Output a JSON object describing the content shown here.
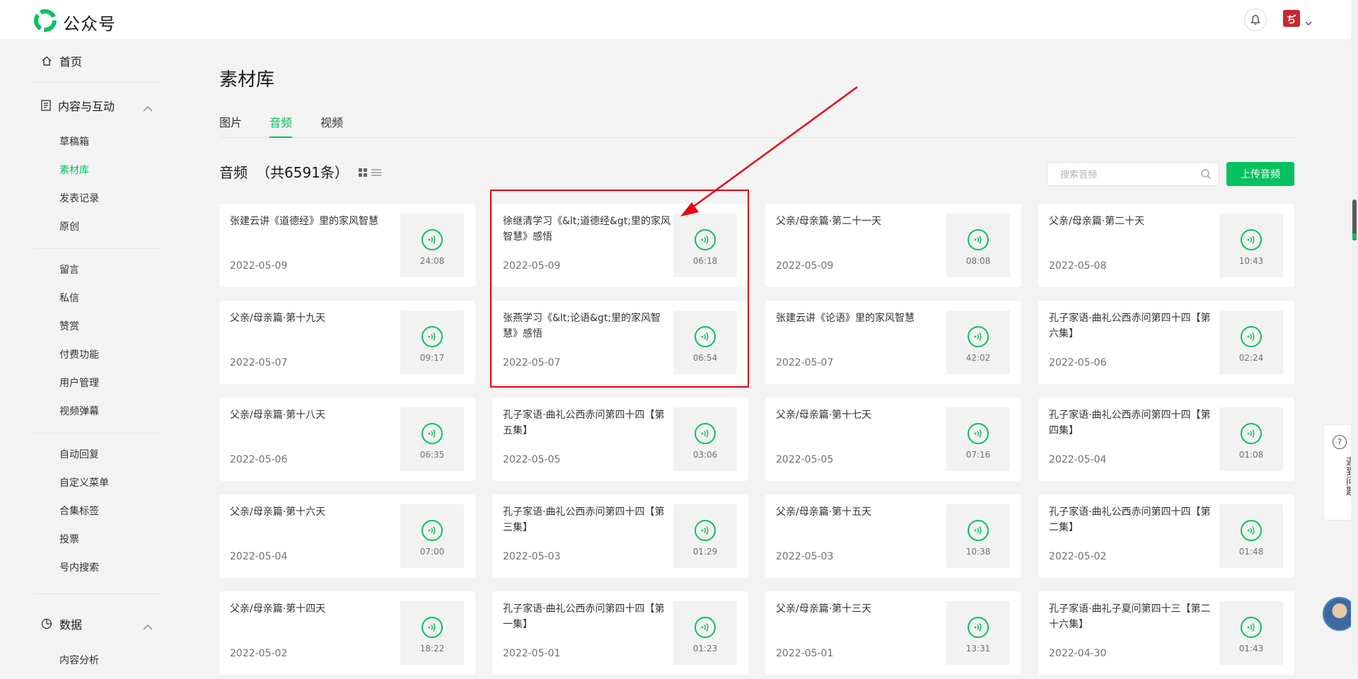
{
  "brand": {
    "name": "公众号",
    "logo_icon": "wechat-official-account-icon",
    "accent": "#07c160"
  },
  "header": {
    "bell_icon": "bell-icon",
    "account_avatar_text": "ぢ"
  },
  "sidebar": {
    "home": "首页",
    "content_group": {
      "label": "内容与互动",
      "items": [
        "草稿箱",
        "素材库",
        "发表记录",
        "原创",
        "留言",
        "私信",
        "赞赏",
        "付费功能",
        "用户管理",
        "视频弹幕",
        "自动回复",
        "自定义菜单",
        "合集标签",
        "投票",
        "号内搜索"
      ],
      "active": "素材库"
    },
    "data_group": {
      "label": "数据",
      "items": [
        "内容分析"
      ]
    }
  },
  "main": {
    "title": "素材库",
    "tabs": [
      "图片",
      "音频",
      "视频"
    ],
    "active_tab": "音频",
    "list_title": "音频",
    "count_text": "（共6591条）",
    "search_placeholder": "搜索音频",
    "upload_label": "上传音频"
  },
  "cards": [
    {
      "title": "张建云讲《道德经》里的家风智慧",
      "date": "2022-05-09",
      "duration": "24:08"
    },
    {
      "title": "徐继清学习《&lt;道德经&gt;里的家风智慧》感悟",
      "date": "2022-05-09",
      "duration": "06:18"
    },
    {
      "title": "父亲/母亲篇·第二十一天",
      "date": "2022-05-09",
      "duration": "08:08"
    },
    {
      "title": "父亲/母亲篇·第二十天",
      "date": "2022-05-08",
      "duration": "10:43"
    },
    {
      "title": "父亲/母亲篇·第十九天",
      "date": "2022-05-07",
      "duration": "09:17"
    },
    {
      "title": "张燕学习《&lt;论语&gt;里的家风智慧》感悟",
      "date": "2022-05-07",
      "duration": "06:54"
    },
    {
      "title": "张建云讲《论语》里的家风智慧",
      "date": "2022-05-07",
      "duration": "42:02"
    },
    {
      "title": "孔子家语·曲礼公西赤问第四十四【第六集】",
      "date": "2022-05-06",
      "duration": "02:24"
    },
    {
      "title": "父亲/母亲篇·第十八天",
      "date": "2022-05-06",
      "duration": "06:35"
    },
    {
      "title": "孔子家语·曲礼公西赤问第四十四【第五集】",
      "date": "2022-05-05",
      "duration": "03:06"
    },
    {
      "title": "父亲/母亲篇·第十七天",
      "date": "2022-05-05",
      "duration": "07:16"
    },
    {
      "title": "孔子家语·曲礼公西赤问第四十四【第四集】",
      "date": "2022-05-04",
      "duration": "01:08"
    },
    {
      "title": "父亲/母亲篇·第十六天",
      "date": "2022-05-04",
      "duration": "07:00"
    },
    {
      "title": "孔子家语·曲礼公西赤问第四十四【第三集】",
      "date": "2022-05-03",
      "duration": "01:29"
    },
    {
      "title": "父亲/母亲篇·第十五天",
      "date": "2022-05-03",
      "duration": "10:38"
    },
    {
      "title": "孔子家语·曲礼公西赤问第四十四【第二集】",
      "date": "2022-05-02",
      "duration": "01:48"
    },
    {
      "title": "父亲/母亲篇·第十四天",
      "date": "2022-05-02",
      "duration": "18:22"
    },
    {
      "title": "孔子家语·曲礼公西赤问第四十四【第一集】",
      "date": "2022-05-01",
      "duration": "01:23"
    },
    {
      "title": "父亲/母亲篇·第十三天",
      "date": "2022-05-01",
      "duration": "13:31"
    },
    {
      "title": "孔子家语·曲礼子夏问第四十三【第二十六集】",
      "date": "2022-04-30",
      "duration": "01:43"
    }
  ],
  "help": {
    "icon": "question-icon",
    "label": "遇到问题"
  },
  "annotation": {
    "color": "#e60012"
  }
}
